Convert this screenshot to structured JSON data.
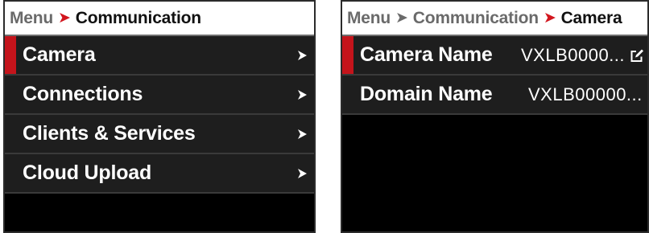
{
  "left_panel": {
    "breadcrumb": {
      "parent": "Menu",
      "current": "Communication"
    },
    "items": [
      {
        "label": "Camera",
        "selected": true,
        "icon": "chevron-right-icon"
      },
      {
        "label": "Connections",
        "selected": false,
        "icon": "chevron-right-icon"
      },
      {
        "label": "Clients & Services",
        "selected": false,
        "icon": "chevron-right-icon"
      },
      {
        "label": "Cloud Upload",
        "selected": false,
        "icon": "chevron-right-icon"
      }
    ]
  },
  "right_panel": {
    "breadcrumb": {
      "root": "Menu",
      "parent": "Communication",
      "current": "Camera"
    },
    "items": [
      {
        "label": "Camera Name",
        "value": "VXLB0000...",
        "selected": true,
        "icon": "edit-icon"
      },
      {
        "label": "Domain Name",
        "value": "VXLB00000...",
        "selected": false
      }
    ]
  },
  "colors": {
    "accent_red": "#c4141b",
    "row_bg": "#1e1e1e",
    "panel_bg": "#000000",
    "breadcrumb_bg": "#ffffff"
  }
}
